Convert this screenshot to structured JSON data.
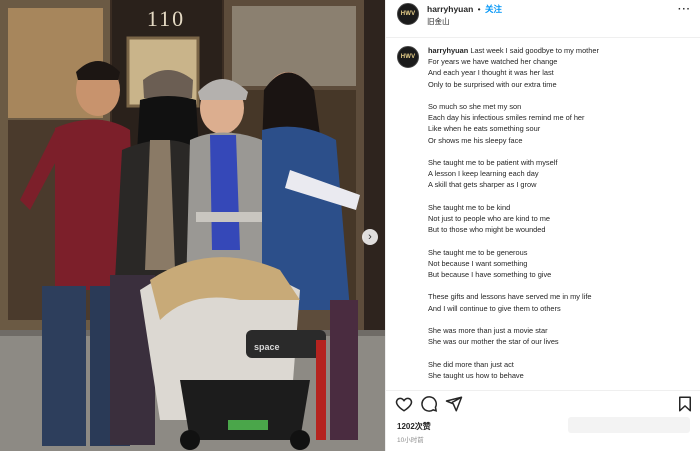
{
  "photo": {
    "address_number": "110",
    "stroller_brand": "space",
    "next_icon": "chevron-right-icon"
  },
  "header": {
    "username": "harryhyuan",
    "separator": "•",
    "follow_label": "关注",
    "location": "旧金山",
    "avatar_text": "HWV",
    "more_icon": "ellipsis-icon"
  },
  "caption": {
    "username": "harryhyuan",
    "avatar_text": "HWV",
    "lines": [
      "Last week I said goodbye to my mother",
      "For years we have watched her change",
      "And each year I thought it was her last",
      "Only to be surprised with our extra time",
      "",
      "So much so she met my son",
      "Each day his infectious smiles remind me of her",
      "Like when he eats something sour",
      "Or shows me his sleepy face",
      "",
      "She taught me to be patient with myself",
      "A lesson I keep learning each day",
      "A skill that gets sharper as I grow",
      "",
      "She taught me to be kind",
      "Not just to people who are kind to me",
      "But to those who might be wounded",
      "",
      "She taught me to be generous",
      "Not because I want something",
      "But because I have something to give",
      "",
      "These gifts and lessons have served me in my life",
      "And I will continue to give them to others",
      "",
      "She was more than just a movie star",
      "She was our mother the star of our lives",
      "",
      "She did more than just act",
      "She taught us how to behave"
    ]
  },
  "actions": {
    "like_icon": "heart-icon",
    "comment_icon": "comment-icon",
    "share_icon": "send-icon",
    "save_icon": "bookmark-icon",
    "likes": "1202次赞",
    "time": "10小时前"
  },
  "colors": {
    "follow": "#0095f6",
    "text": "#262626",
    "muted": "#8e8e8e"
  }
}
